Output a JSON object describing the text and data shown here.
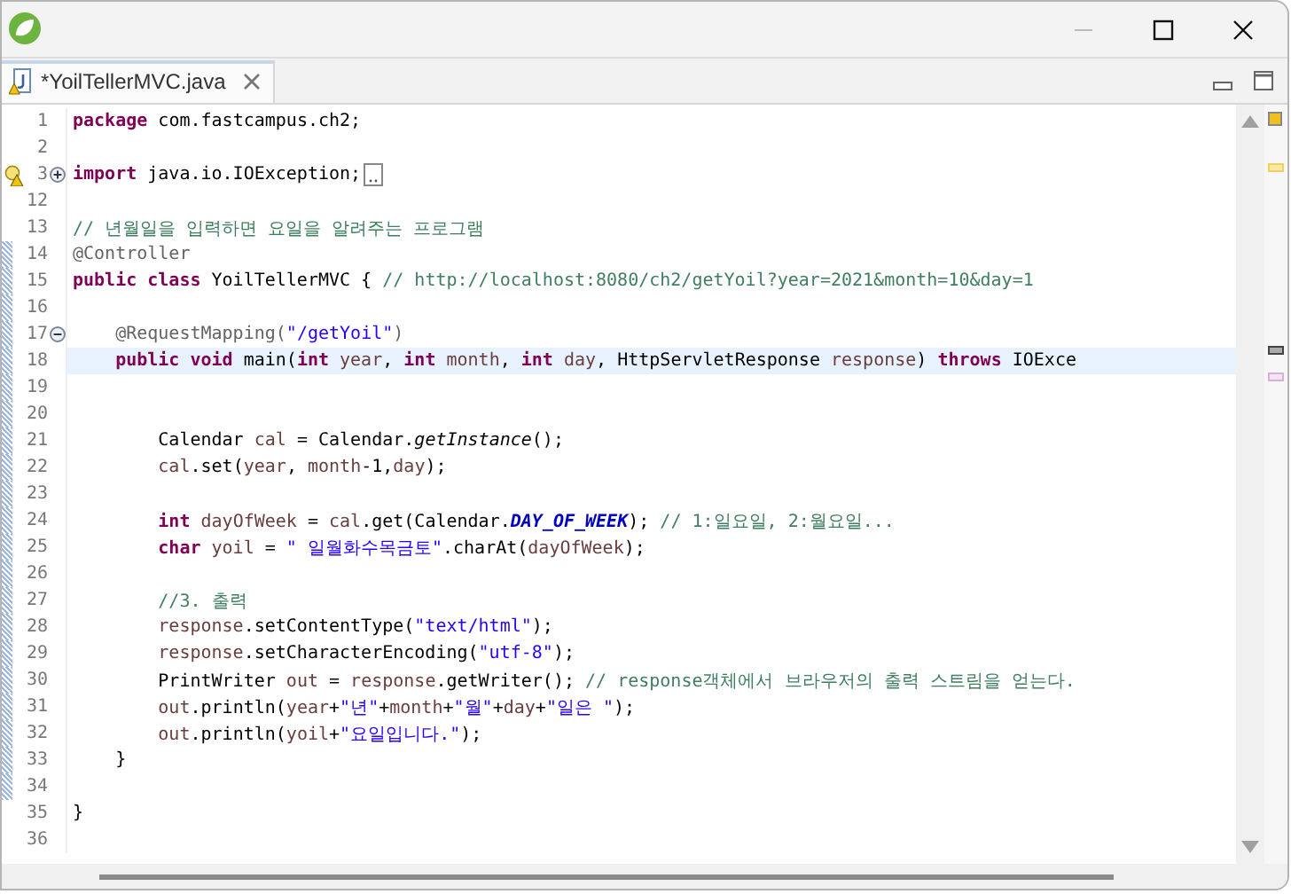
{
  "tabs": [
    {
      "label": "*YoilTellerMVC.java",
      "selected": true
    }
  ],
  "editor": {
    "lines": [
      {
        "number": "1",
        "tokens": [
          {
            "kind": "keyword",
            "text": "package"
          },
          {
            "kind": "plain",
            "text": " com.fastcampus.ch2;"
          }
        ]
      },
      {
        "number": "2"
      },
      {
        "number": "3",
        "collapsed": true,
        "warning": true,
        "tokens": [
          {
            "kind": "keyword",
            "text": "import"
          },
          {
            "kind": "plain",
            "text": " java.io.IOException;"
          }
        ]
      },
      {
        "number": "12"
      },
      {
        "number": "13",
        "tokens": [
          {
            "kind": "comment",
            "text": "// 년월일을 입력하면 요일을 알려주는 프로그램"
          }
        ]
      },
      {
        "number": "14",
        "tokens": [
          {
            "kind": "annotation",
            "text": "@Controller"
          }
        ]
      },
      {
        "number": "15",
        "tokens": [
          {
            "kind": "keyword",
            "text": "public class"
          },
          {
            "kind": "plain",
            "text": " YoilTellerMVC { "
          },
          {
            "kind": "comment",
            "text": "// http://localhost:8080/ch2/getYoil?year=2021&month=10&day=1"
          }
        ]
      },
      {
        "number": "16"
      },
      {
        "number": "17",
        "collapsed": false,
        "tokens": [
          {
            "kind": "annotation",
            "text": "    @RequestMapping("
          },
          {
            "kind": "string",
            "text": "\"/getYoil\""
          },
          {
            "kind": "annotation",
            "text": ")"
          }
        ]
      },
      {
        "number": "18",
        "current": true,
        "tokens": [
          {
            "kind": "keyword",
            "text": "    public void"
          },
          {
            "kind": "plain",
            "text": " main("
          },
          {
            "kind": "keyword",
            "text": "int"
          },
          {
            "kind": "param",
            "text": " year"
          },
          {
            "kind": "plain",
            "text": ", "
          },
          {
            "kind": "keyword",
            "text": "int"
          },
          {
            "kind": "param",
            "text": " month"
          },
          {
            "kind": "plain",
            "text": ", "
          },
          {
            "kind": "keyword",
            "text": "int"
          },
          {
            "kind": "param",
            "text": " day"
          },
          {
            "kind": "plain",
            "text": ", HttpServletResponse "
          },
          {
            "kind": "param",
            "text": "response"
          },
          {
            "kind": "plain",
            "text": ") "
          },
          {
            "kind": "keyword",
            "text": "throws"
          },
          {
            "kind": "plain",
            "text": " IOExce"
          }
        ]
      },
      {
        "number": "19"
      },
      {
        "number": "20"
      },
      {
        "number": "21",
        "tokens": [
          {
            "kind": "plain",
            "text": "        Calendar "
          },
          {
            "kind": "local",
            "text": "cal"
          },
          {
            "kind": "plain",
            "text": " = Calendar."
          },
          {
            "kind": "static",
            "text": "getInstance"
          },
          {
            "kind": "plain",
            "text": "();"
          }
        ]
      },
      {
        "number": "22",
        "tokens": [
          {
            "kind": "local",
            "text": "        cal"
          },
          {
            "kind": "plain",
            "text": ".set("
          },
          {
            "kind": "param",
            "text": "year"
          },
          {
            "kind": "plain",
            "text": ", "
          },
          {
            "kind": "param",
            "text": "month"
          },
          {
            "kind": "plain",
            "text": "-1,"
          },
          {
            "kind": "param",
            "text": "day"
          },
          {
            "kind": "plain",
            "text": ");"
          }
        ]
      },
      {
        "number": "23"
      },
      {
        "number": "24",
        "tokens": [
          {
            "kind": "keyword",
            "text": "        int"
          },
          {
            "kind": "local",
            "text": " dayOfWeek"
          },
          {
            "kind": "plain",
            "text": " = "
          },
          {
            "kind": "local",
            "text": "cal"
          },
          {
            "kind": "plain",
            "text": ".get(Calendar."
          },
          {
            "kind": "constant",
            "text": "DAY_OF_WEEK"
          },
          {
            "kind": "plain",
            "text": "); "
          },
          {
            "kind": "comment",
            "text": "// 1:일요일, 2:월요일..."
          }
        ]
      },
      {
        "number": "25",
        "tokens": [
          {
            "kind": "keyword",
            "text": "        char"
          },
          {
            "kind": "local",
            "text": " yoil"
          },
          {
            "kind": "plain",
            "text": " = "
          },
          {
            "kind": "string",
            "text": "\" 일월화수목금토\""
          },
          {
            "kind": "plain",
            "text": ".charAt("
          },
          {
            "kind": "local",
            "text": "dayOfWeek"
          },
          {
            "kind": "plain",
            "text": ");"
          }
        ]
      },
      {
        "number": "26"
      },
      {
        "number": "27",
        "tokens": [
          {
            "kind": "comment",
            "text": "        //3. 출력"
          }
        ]
      },
      {
        "number": "28",
        "tokens": [
          {
            "kind": "param",
            "text": "        response"
          },
          {
            "kind": "plain",
            "text": ".setContentType("
          },
          {
            "kind": "string",
            "text": "\"text/html\""
          },
          {
            "kind": "plain",
            "text": ");"
          }
        ]
      },
      {
        "number": "29",
        "tokens": [
          {
            "kind": "param",
            "text": "        response"
          },
          {
            "kind": "plain",
            "text": ".setCharacterEncoding("
          },
          {
            "kind": "string",
            "text": "\"utf-8\""
          },
          {
            "kind": "plain",
            "text": ");"
          }
        ]
      },
      {
        "number": "30",
        "tokens": [
          {
            "kind": "plain",
            "text": "        PrintWriter "
          },
          {
            "kind": "local",
            "text": "out"
          },
          {
            "kind": "plain",
            "text": " = "
          },
          {
            "kind": "param",
            "text": "response"
          },
          {
            "kind": "plain",
            "text": ".getWriter(); "
          },
          {
            "kind": "comment",
            "text": "// response객체에서 브라우저의 출력 스트림을 얻는다."
          }
        ]
      },
      {
        "number": "31",
        "tokens": [
          {
            "kind": "local",
            "text": "        out"
          },
          {
            "kind": "plain",
            "text": ".println("
          },
          {
            "kind": "param",
            "text": "year"
          },
          {
            "kind": "plain",
            "text": "+"
          },
          {
            "kind": "string",
            "text": "\"년\""
          },
          {
            "kind": "plain",
            "text": "+"
          },
          {
            "kind": "param",
            "text": "month"
          },
          {
            "kind": "plain",
            "text": "+"
          },
          {
            "kind": "string",
            "text": "\"월\""
          },
          {
            "kind": "plain",
            "text": "+"
          },
          {
            "kind": "param",
            "text": "day"
          },
          {
            "kind": "plain",
            "text": "+"
          },
          {
            "kind": "string",
            "text": "\"일은 \""
          },
          {
            "kind": "plain",
            "text": ");"
          }
        ]
      },
      {
        "number": "32",
        "tokens": [
          {
            "kind": "local",
            "text": "        out"
          },
          {
            "kind": "plain",
            "text": ".println("
          },
          {
            "kind": "local",
            "text": "yoil"
          },
          {
            "kind": "plain",
            "text": "+"
          },
          {
            "kind": "string",
            "text": "\"요일입니다.\""
          },
          {
            "kind": "plain",
            "text": ");"
          }
        ]
      },
      {
        "number": "33",
        "tokens": [
          {
            "kind": "plain",
            "text": "    }"
          }
        ]
      },
      {
        "number": "34"
      },
      {
        "number": "35",
        "tokens": [
          {
            "kind": "plain",
            "text": "}"
          }
        ]
      },
      {
        "number": "36"
      }
    ]
  }
}
